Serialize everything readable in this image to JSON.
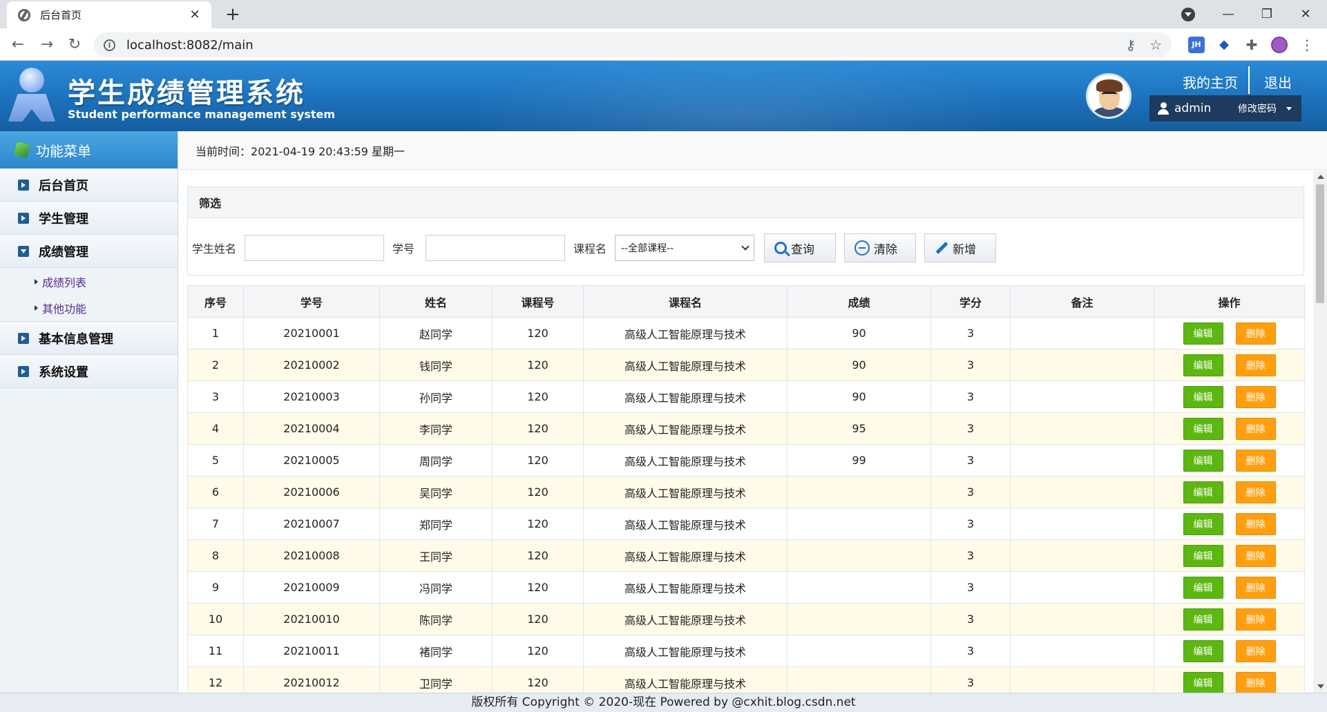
{
  "browser": {
    "tab_title": "后台首页",
    "url": "localhost:8082/main",
    "extension_label": "JH"
  },
  "header": {
    "title": "学生成绩管理系统",
    "subtitle": "Student performance management system",
    "home_link": "我的主页",
    "logout_link": "退出",
    "username": "admin",
    "change_password": "修改密码"
  },
  "sidebar": {
    "title": "功能菜单",
    "items": [
      {
        "label": "后台首页"
      },
      {
        "label": "学生管理"
      },
      {
        "label": "成绩管理"
      },
      {
        "label": "基本信息管理"
      },
      {
        "label": "系统设置"
      }
    ],
    "sub_items": [
      {
        "label": "成绩列表"
      },
      {
        "label": "其他功能"
      }
    ]
  },
  "timebar": {
    "label": "当前时间：",
    "value": "2021-04-19 20:43:59 星期一"
  },
  "filter": {
    "title": "筛选",
    "name_label": "学生姓名",
    "id_label": "学号",
    "course_label": "课程名",
    "course_selected": "--全部课程--",
    "query_button": "查询",
    "clear_button": "清除",
    "add_button": "新增"
  },
  "table": {
    "headers": [
      "序号",
      "学号",
      "姓名",
      "课程号",
      "课程名",
      "成绩",
      "学分",
      "备注",
      "操作"
    ],
    "edit_label": "编辑",
    "delete_label": "删除",
    "rows": [
      {
        "no": "1",
        "sid": "20210001",
        "name": "赵同学",
        "cid": "120",
        "course": "高级人工智能原理与技术",
        "score": "90",
        "credit": "3",
        "note": ""
      },
      {
        "no": "2",
        "sid": "20210002",
        "name": "钱同学",
        "cid": "120",
        "course": "高级人工智能原理与技术",
        "score": "90",
        "credit": "3",
        "note": ""
      },
      {
        "no": "3",
        "sid": "20210003",
        "name": "孙同学",
        "cid": "120",
        "course": "高级人工智能原理与技术",
        "score": "90",
        "credit": "3",
        "note": ""
      },
      {
        "no": "4",
        "sid": "20210004",
        "name": "李同学",
        "cid": "120",
        "course": "高级人工智能原理与技术",
        "score": "95",
        "credit": "3",
        "note": ""
      },
      {
        "no": "5",
        "sid": "20210005",
        "name": "周同学",
        "cid": "120",
        "course": "高级人工智能原理与技术",
        "score": "99",
        "credit": "3",
        "note": ""
      },
      {
        "no": "6",
        "sid": "20210006",
        "name": "吴同学",
        "cid": "120",
        "course": "高级人工智能原理与技术",
        "score": "",
        "credit": "3",
        "note": ""
      },
      {
        "no": "7",
        "sid": "20210007",
        "name": "郑同学",
        "cid": "120",
        "course": "高级人工智能原理与技术",
        "score": "",
        "credit": "3",
        "note": ""
      },
      {
        "no": "8",
        "sid": "20210008",
        "name": "王同学",
        "cid": "120",
        "course": "高级人工智能原理与技术",
        "score": "",
        "credit": "3",
        "note": ""
      },
      {
        "no": "9",
        "sid": "20210009",
        "name": "冯同学",
        "cid": "120",
        "course": "高级人工智能原理与技术",
        "score": "",
        "credit": "3",
        "note": ""
      },
      {
        "no": "10",
        "sid": "20210010",
        "name": "陈同学",
        "cid": "120",
        "course": "高级人工智能原理与技术",
        "score": "",
        "credit": "3",
        "note": ""
      },
      {
        "no": "11",
        "sid": "20210011",
        "name": "褚同学",
        "cid": "120",
        "course": "高级人工智能原理与技术",
        "score": "",
        "credit": "3",
        "note": ""
      },
      {
        "no": "12",
        "sid": "20210012",
        "name": "卫同学",
        "cid": "120",
        "course": "高级人工智能原理与技术",
        "score": "",
        "credit": "3",
        "note": ""
      }
    ]
  },
  "footer": {
    "text": "版权所有 Copyright © 2020-现在 Powered by @cxhit.blog.csdn.net"
  }
}
